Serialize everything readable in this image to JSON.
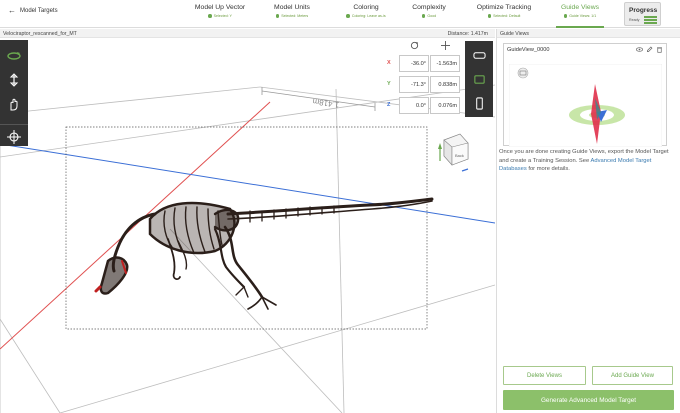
{
  "header": {
    "back_label": "Model Targets",
    "steps": [
      {
        "label": "Model Up Vector",
        "sub": "Selected: Y"
      },
      {
        "label": "Model Units",
        "sub": "Selected: Meters"
      },
      {
        "label": "Coloring",
        "sub": "Coloring: Leave as-is"
      },
      {
        "label": "Complexity",
        "sub": "Good"
      },
      {
        "label": "Optimize Tracking",
        "sub": "Selected: Default"
      },
      {
        "label": "Guide Views",
        "sub": "Guide Views: 1/1"
      }
    ],
    "progress": {
      "title": "Progress",
      "sub": "Ready"
    }
  },
  "viewport": {
    "model_name": "Velociraptor_rescanned_for_MT",
    "distance": "Distance: 1.417m",
    "transform": {
      "x": {
        "label": "X",
        "rotation": "-36.0°",
        "position": "-1.563m"
      },
      "y": {
        "label": "Y",
        "rotation": "-71.3°",
        "position": "0.838m"
      },
      "z": {
        "label": "Z",
        "rotation": "0.0°",
        "position": "0.076m"
      }
    },
    "cube_face": "Back",
    "ruler_text": "1.418m"
  },
  "panel": {
    "title": "Guide Views",
    "guide_view_name": "GuideView_0000",
    "help_text_1": "Once you are done creating Guide Views, export the Model Target and create a Training Session. See ",
    "help_link": "Advanced Model Target Databases",
    "help_text_2": " for more details.",
    "delete_label": "Delete Views",
    "add_label": "Add Guide View",
    "generate_label": "Generate Advanced Model Target"
  },
  "colors": {
    "accent": "#6aa84f",
    "x_axis": "#e05050",
    "y_axis": "#6aa84f",
    "z_axis": "#3b6fd6",
    "toolbar": "#333333"
  }
}
